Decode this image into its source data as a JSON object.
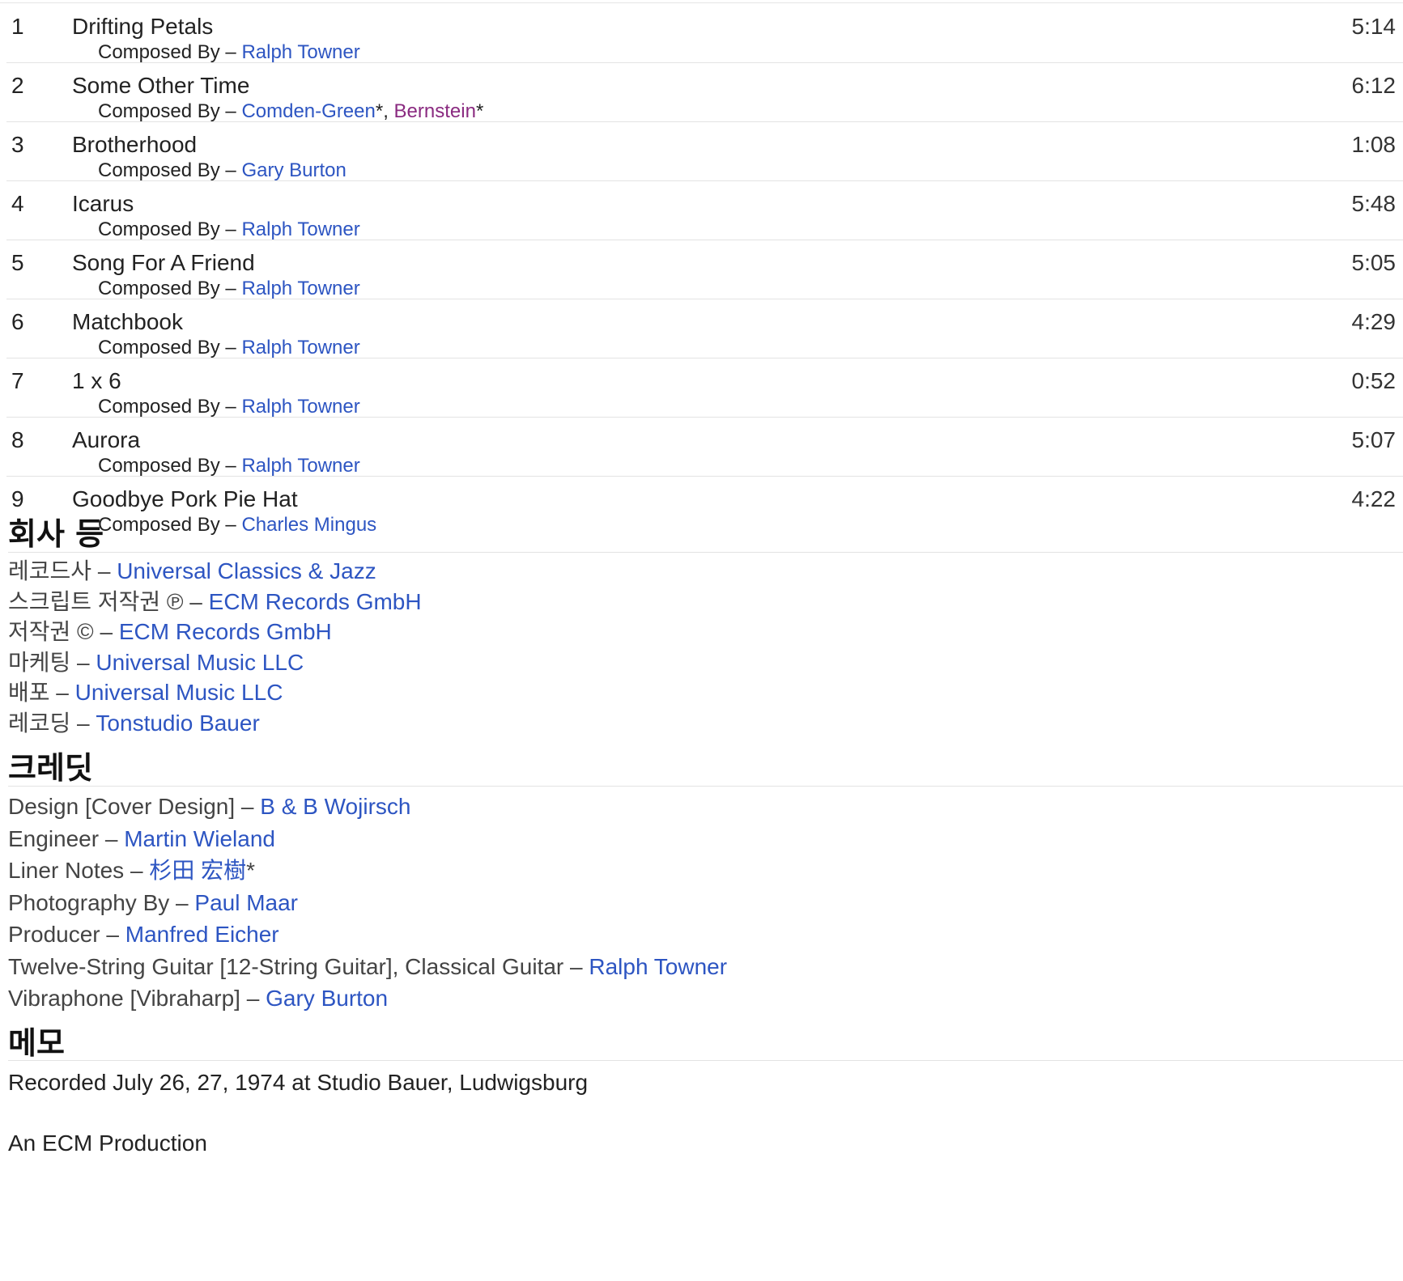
{
  "tracks": [
    {
      "position": "1",
      "title": "Drifting Petals",
      "duration": "5:14",
      "credit_role": "Composed By",
      "composers": [
        {
          "name": "Ralph Towner"
        }
      ]
    },
    {
      "position": "2",
      "title": "Some Other Time",
      "duration": "6:12",
      "credit_role": "Composed By",
      "composers": [
        {
          "name": "Comden-Green",
          "suffix": "*"
        },
        {
          "name": "Bernstein",
          "suffix": "*",
          "visited": true
        }
      ]
    },
    {
      "position": "3",
      "title": "Brotherhood",
      "duration": "1:08",
      "credit_role": "Composed By",
      "composers": [
        {
          "name": "Gary Burton"
        }
      ]
    },
    {
      "position": "4",
      "title": "Icarus",
      "duration": "5:48",
      "credit_role": "Composed By",
      "composers": [
        {
          "name": "Ralph Towner"
        }
      ]
    },
    {
      "position": "5",
      "title": "Song For A Friend",
      "duration": "5:05",
      "credit_role": "Composed By",
      "composers": [
        {
          "name": "Ralph Towner"
        }
      ]
    },
    {
      "position": "6",
      "title": "Matchbook",
      "duration": "4:29",
      "credit_role": "Composed By",
      "composers": [
        {
          "name": "Ralph Towner"
        }
      ]
    },
    {
      "position": "7",
      "title": "1 x 6",
      "duration": "0:52",
      "credit_role": "Composed By",
      "composers": [
        {
          "name": "Ralph Towner"
        }
      ]
    },
    {
      "position": "8",
      "title": "Aurora",
      "duration": "5:07",
      "credit_role": "Composed By",
      "composers": [
        {
          "name": "Ralph Towner"
        }
      ]
    },
    {
      "position": "9",
      "title": "Goodbye Pork Pie Hat",
      "duration": "4:22",
      "credit_role": "Composed By",
      "composers": [
        {
          "name": "Charles Mingus"
        }
      ]
    }
  ],
  "companies": {
    "heading": "회사 등",
    "items": [
      {
        "role": "레코드사",
        "name": "Universal Classics & Jazz"
      },
      {
        "role": "스크립트 저작권 ℗",
        "name": "ECM Records GmbH"
      },
      {
        "role": "저작권 ©",
        "name": "ECM Records GmbH"
      },
      {
        "role": "마케팅",
        "name": "Universal Music LLC"
      },
      {
        "role": "배포",
        "name": "Universal Music LLC"
      },
      {
        "role": "레코딩",
        "name": "Tonstudio Bauer"
      }
    ]
  },
  "credits": {
    "heading": "크레딧",
    "items": [
      {
        "role": "Design [Cover Design]",
        "name": "B & B Wojirsch"
      },
      {
        "role": "Engineer",
        "name": "Martin Wieland"
      },
      {
        "role": "Liner Notes",
        "name": "杉田 宏樹",
        "suffix": "*"
      },
      {
        "role": "Photography By",
        "name": "Paul Maar"
      },
      {
        "role": "Producer",
        "name": "Manfred Eicher"
      },
      {
        "role": "Twelve-String Guitar [12-String Guitar], Classical Guitar",
        "name": "Ralph Towner"
      },
      {
        "role": "Vibraphone [Vibraharp]",
        "name": "Gary Burton"
      }
    ]
  },
  "notes": {
    "heading": "메모",
    "lines": [
      "Recorded July 26, 27, 1974 at Studio Bauer, Ludwigsburg",
      "An ECM Production"
    ]
  },
  "separator": " – ",
  "colors": {
    "link": "#2d55c2",
    "visited_link": "#8a2a80",
    "divider": "#e3e3e3"
  }
}
